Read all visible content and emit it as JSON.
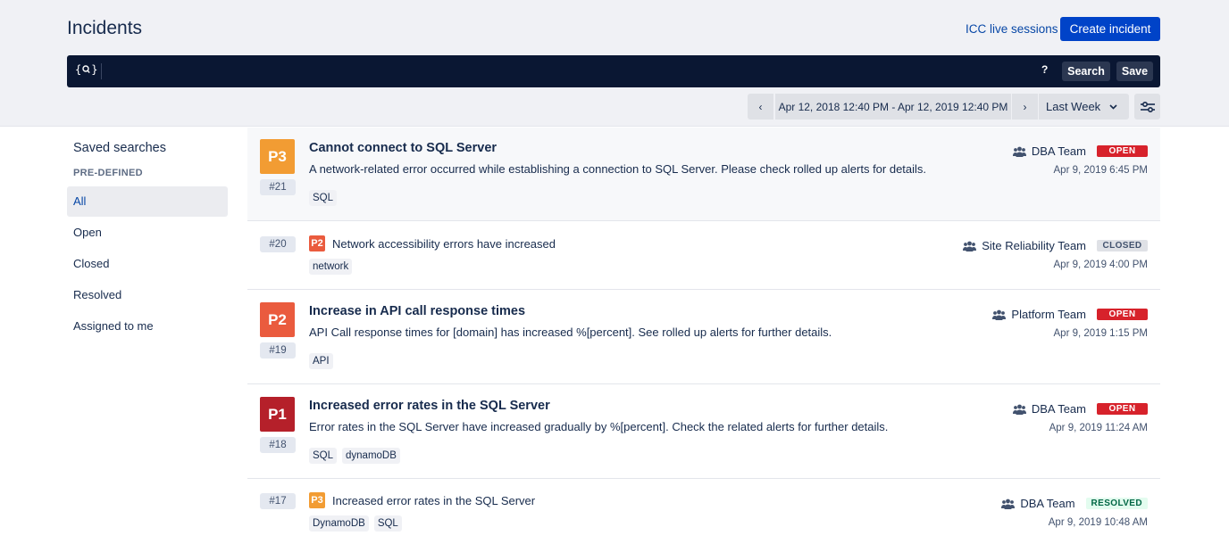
{
  "header": {
    "title": "Incidents",
    "icc_link": "ICC live sessions",
    "create_button": "Create incident"
  },
  "search": {
    "icon": "search-query-icon",
    "query": "",
    "placeholder": "",
    "help_label": "?",
    "search_label": "Search",
    "save_label": "Save"
  },
  "date_filter": {
    "prev_label": "‹",
    "range": "Apr 12, 2018 12:40 PM - Apr 12, 2019 12:40 PM",
    "next_label": "›",
    "preset": "Last Week",
    "preset_chevron": "⌄",
    "filter_icon": "sliders-icon"
  },
  "sidebar": {
    "title": "Saved searches",
    "section": "PRE-DEFINED",
    "items": [
      {
        "label": "All",
        "active": true
      },
      {
        "label": "Open",
        "active": false
      },
      {
        "label": "Closed",
        "active": false
      },
      {
        "label": "Resolved",
        "active": false
      },
      {
        "label": "Assigned to me",
        "active": false
      }
    ]
  },
  "colors": {
    "p1": "#b5202a",
    "p2": "#ea5b3e",
    "p3": "#f29c33",
    "accent": "#0043c8"
  },
  "incidents": [
    {
      "id": "#21",
      "priority": "P3",
      "expanded": true,
      "title": "Cannot connect to SQL Server",
      "description": "A network-related error occurred while establishing a connection to SQL Server. Please check rolled up alerts for details.",
      "tags": [
        "SQL"
      ],
      "team": "DBA Team",
      "status": "OPEN",
      "time": "Apr 9, 2019 6:45 PM"
    },
    {
      "id": "#20",
      "priority": "P2",
      "expanded": false,
      "title": "Network accessibility errors have increased",
      "tags": [
        "network"
      ],
      "team": "Site Reliability Team",
      "status": "CLOSED",
      "time": "Apr 9, 2019 4:00 PM"
    },
    {
      "id": "#19",
      "priority": "P2",
      "expanded": true,
      "title": "Increase in API call response times",
      "description": "API Call response times for [domain] has increased %[percent]. See rolled up alerts for further details.",
      "tags": [
        "API"
      ],
      "team": "Platform Team",
      "status": "OPEN",
      "time": "Apr 9, 2019 1:15 PM"
    },
    {
      "id": "#18",
      "priority": "P1",
      "expanded": true,
      "title": "Increased error rates in the SQL Server",
      "description": "Error rates in the SQL Server have increased gradually by %[percent]. Check the related alerts for further details.",
      "tags": [
        "SQL",
        "dynamoDB"
      ],
      "team": "DBA Team",
      "status": "OPEN",
      "time": "Apr 9, 2019 11:24 AM"
    },
    {
      "id": "#17",
      "priority": "P3",
      "expanded": false,
      "title": "Increased error rates in the SQL Server",
      "tags": [
        "DynamoDB",
        "SQL"
      ],
      "team": "DBA Team",
      "status": "RESOLVED",
      "time": "Apr 9, 2019 10:48 AM"
    }
  ]
}
